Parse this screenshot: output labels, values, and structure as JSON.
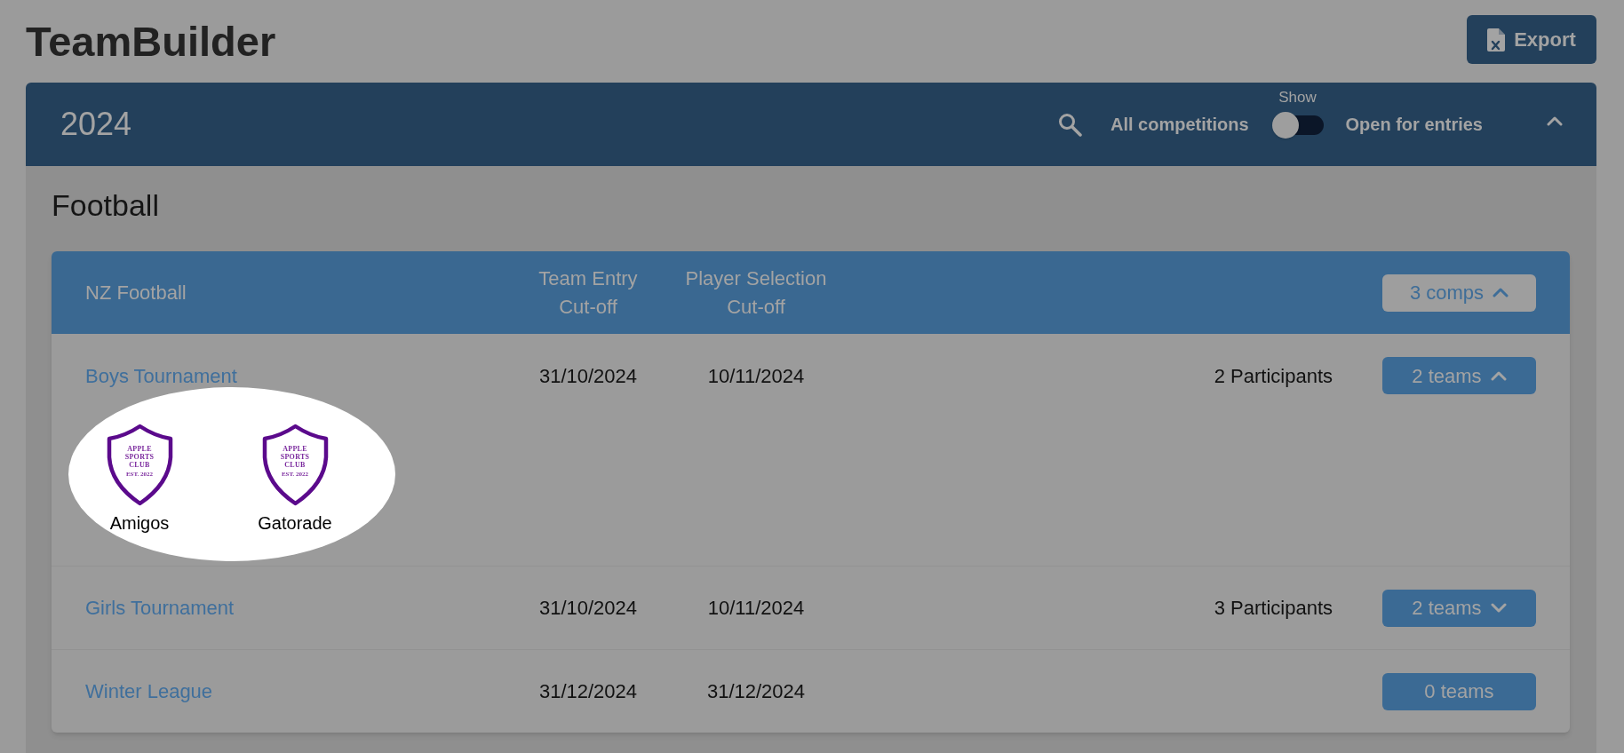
{
  "header": {
    "title": "TeamBuilder",
    "export_label": "Export"
  },
  "season": {
    "year": "2024",
    "expanded": true,
    "filter": {
      "label": "Show",
      "left_option": "All competitions",
      "right_option": "Open for entries",
      "on": false
    }
  },
  "sport": {
    "title": "Football"
  },
  "competition": {
    "name": "NZ Football",
    "columns": [
      "Team Entry Cut-off",
      "Player Selection Cut-off"
    ],
    "comps_button": {
      "label": "3 comps",
      "expanded": true
    },
    "rows": [
      {
        "name": "Boys Tournament",
        "team_entry_cutoff": "31/10/2024",
        "player_selection_cutoff": "10/11/2024",
        "participants": "2 Participants",
        "teams_button": {
          "label": "2 teams",
          "expanded": true
        },
        "teams_spotlight": true,
        "teams": [
          {
            "name": "Amigos",
            "logo": {
              "title": "APPLE SPORTS CLUB",
              "subtitle": "EST. 2022"
            }
          },
          {
            "name": "Gatorade",
            "logo": {
              "title": "APPLE SPORTS CLUB",
              "subtitle": "EST. 2022"
            }
          }
        ]
      },
      {
        "name": "Girls Tournament",
        "team_entry_cutoff": "31/10/2024",
        "player_selection_cutoff": "10/11/2024",
        "participants": "3 Participants",
        "teams_button": {
          "label": "2 teams",
          "expanded": false
        }
      },
      {
        "name": "Winter League",
        "team_entry_cutoff": "31/12/2024",
        "player_selection_cutoff": "31/12/2024",
        "teams_button": {
          "label": "0 teams"
        }
      }
    ]
  }
}
